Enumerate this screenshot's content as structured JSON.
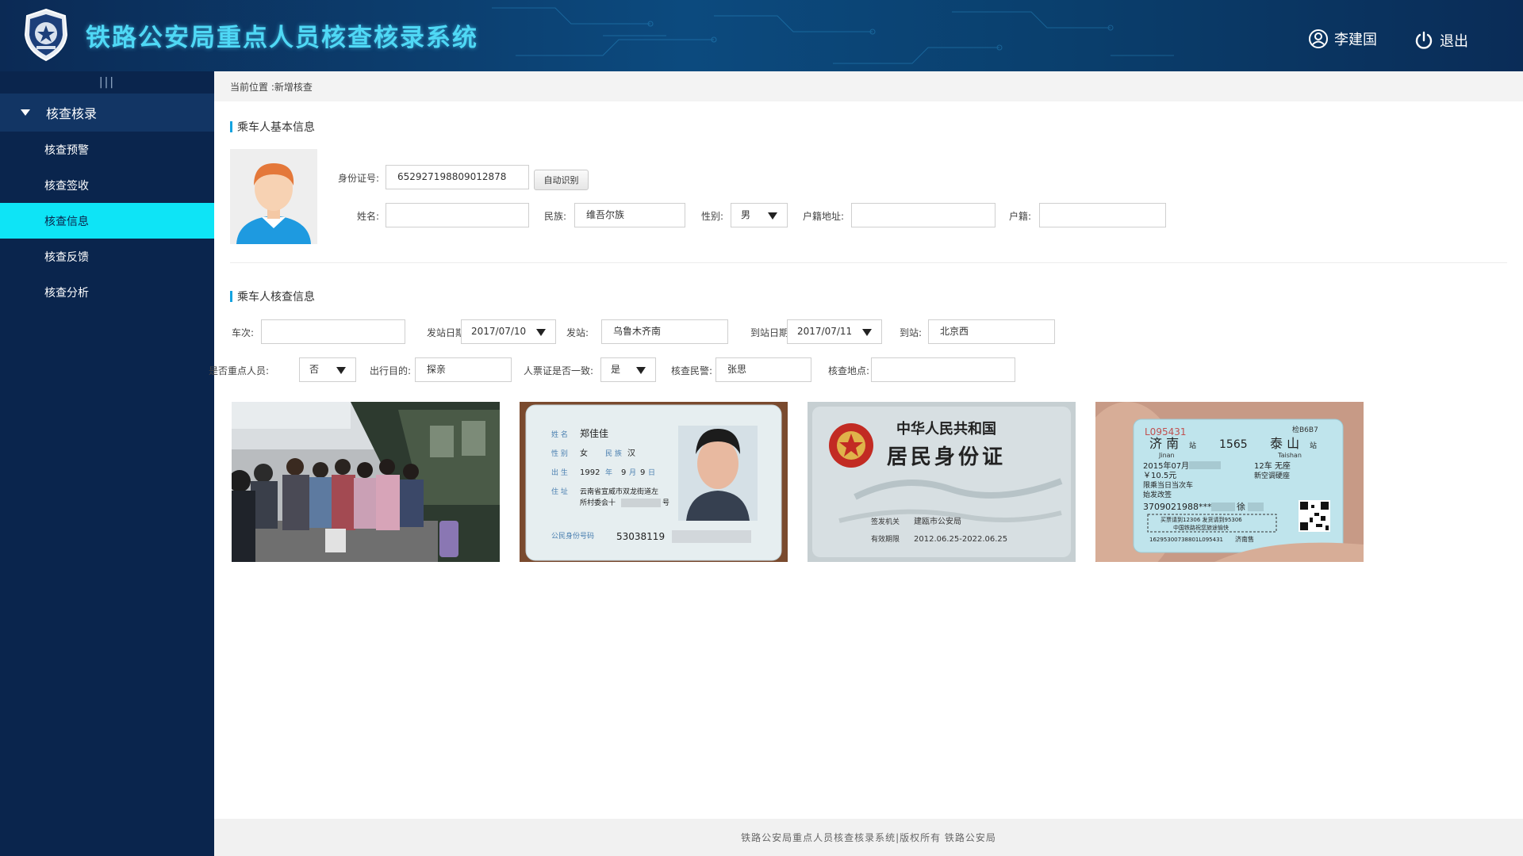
{
  "header": {
    "app_title": "铁路公安局重点人员核查核录系统",
    "user_name": "李建国",
    "logout_label": "退出"
  },
  "sidebar": {
    "collapse_glyph": "|||",
    "group_label": "核查核录",
    "items": [
      {
        "label": "核查预警",
        "active": false
      },
      {
        "label": "核查签收",
        "active": false
      },
      {
        "label": "核查信息",
        "active": true
      },
      {
        "label": "核查反馈",
        "active": false
      },
      {
        "label": "核查分析",
        "active": false
      }
    ]
  },
  "breadcrumb": "当前位置 :新增核查",
  "basic_info": {
    "section_title": "乘车人基本信息",
    "id_label": "身份证号:",
    "id_value": "652927198809012878",
    "auto_recognize_label": "自动识别",
    "name_label": "姓名:",
    "name_value": "",
    "ethnicity_label": "民族:",
    "ethnicity_value": "维吾尔族",
    "gender_label": "性别:",
    "gender_value": "男",
    "address_label": "户籍地址:",
    "address_value": "",
    "household_label": "户籍:",
    "household_value": ""
  },
  "check_info": {
    "section_title": "乘车人核查信息",
    "train_label": "车次:",
    "train_value": "",
    "depart_date_label": "发站日期:",
    "depart_date_value": "2017/07/10",
    "depart_station_label": "发站:",
    "depart_station_value": "乌鲁木齐南",
    "arrive_date_label": "到站日期:",
    "arrive_date_value": "2017/07/11",
    "arrive_station_label": "到站:",
    "arrive_station_value": "北京西",
    "key_person_label": "是否重点人员:",
    "key_person_value": "否",
    "purpose_label": "出行目的:",
    "purpose_value": "探亲",
    "ticket_match_label": "人票证是否一致:",
    "ticket_match_value": "是",
    "officer_label": "核查民警:",
    "officer_value": "张思",
    "location_label": "核查地点:",
    "location_value": ""
  },
  "photos": {
    "id_front": {
      "name_key": "姓 名",
      "name": "郑佳佳",
      "gender_key": "性 别",
      "gender": "女",
      "ethnic_key": "民 族",
      "ethnic": "汉",
      "birth_key": "出 生",
      "birth_year": "1992",
      "year_unit": "年",
      "birth_month": "9",
      "month_unit": "月",
      "birth_day": "9",
      "day_unit": "日",
      "addr_key": "住 址",
      "addr_line1": "云南省宣威市双龙街道左",
      "addr_line2a": "所村委会十",
      "addr_line2b": "号",
      "idno_key": "公民身份号码",
      "idno": "53038119"
    },
    "id_back": {
      "country": "中华人民共和国",
      "title": "居民身份证",
      "issuer_key": "签发机关",
      "issuer": "建瓯市公安局",
      "valid_key": "有效期限",
      "valid": "2012.06.25-2022.06.25"
    },
    "ticket": {
      "serial": "L095431",
      "gate": "检B6B7",
      "from": "济 南",
      "from_suffix": "站",
      "train": "1565",
      "to": "泰 山",
      "to_suffix": "站",
      "from_pinyin": "Jinan",
      "to_pinyin": "Taishan",
      "date": "2015年07月",
      "car": "12车 无座",
      "price": "￥10.5元",
      "berth": "新空调硬座",
      "note1": "限乘当日当次车",
      "note2": "始发改签",
      "idno": "3709021988****",
      "holder": "徐",
      "box_line1": "买票请到12306 发货请到95306",
      "box_line2": "中国铁路祝您旅途愉快",
      "bottom_code": "16295300738801L095431",
      "bottom_station": "济南售"
    }
  },
  "footer": "铁路公安局重点人员核查核录系统|版权所有   铁路公安局",
  "colors": {
    "header_bg": "#0c4a7e",
    "sidebar_bg": "#0a254d",
    "active_item": "#0ee4f6",
    "accent_bar": "#14a3e0",
    "title_color": "#4fd8f5"
  }
}
